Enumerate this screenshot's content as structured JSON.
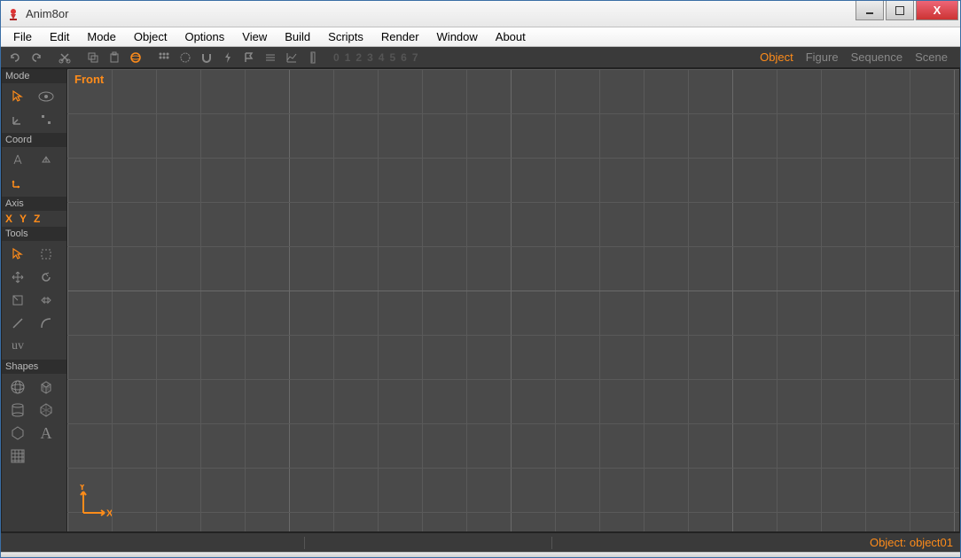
{
  "window": {
    "title": "Anim8or"
  },
  "menu": {
    "items": [
      "File",
      "Edit",
      "Mode",
      "Object",
      "Options",
      "View",
      "Build",
      "Scripts",
      "Render",
      "Window",
      "About"
    ]
  },
  "toolbar": {
    "numbers": [
      "0",
      "1",
      "2",
      "3",
      "4",
      "5",
      "6",
      "7"
    ],
    "mode_tabs": [
      "Object",
      "Figure",
      "Sequence",
      "Scene"
    ],
    "active_mode": "Object"
  },
  "left_panel": {
    "sections": {
      "mode": "Mode",
      "coord": "Coord",
      "axis": "Axis",
      "tools": "Tools",
      "shapes": "Shapes"
    },
    "axis_labels": [
      "X",
      "Y",
      "Z"
    ]
  },
  "viewport": {
    "label": "Front",
    "axis_y": "Y",
    "axis_x": "X"
  },
  "status": {
    "text": "Object: object01"
  },
  "colors": {
    "accent": "#ff8c1a",
    "panel": "#3a3a3a",
    "viewport": "#4a4a4a"
  }
}
